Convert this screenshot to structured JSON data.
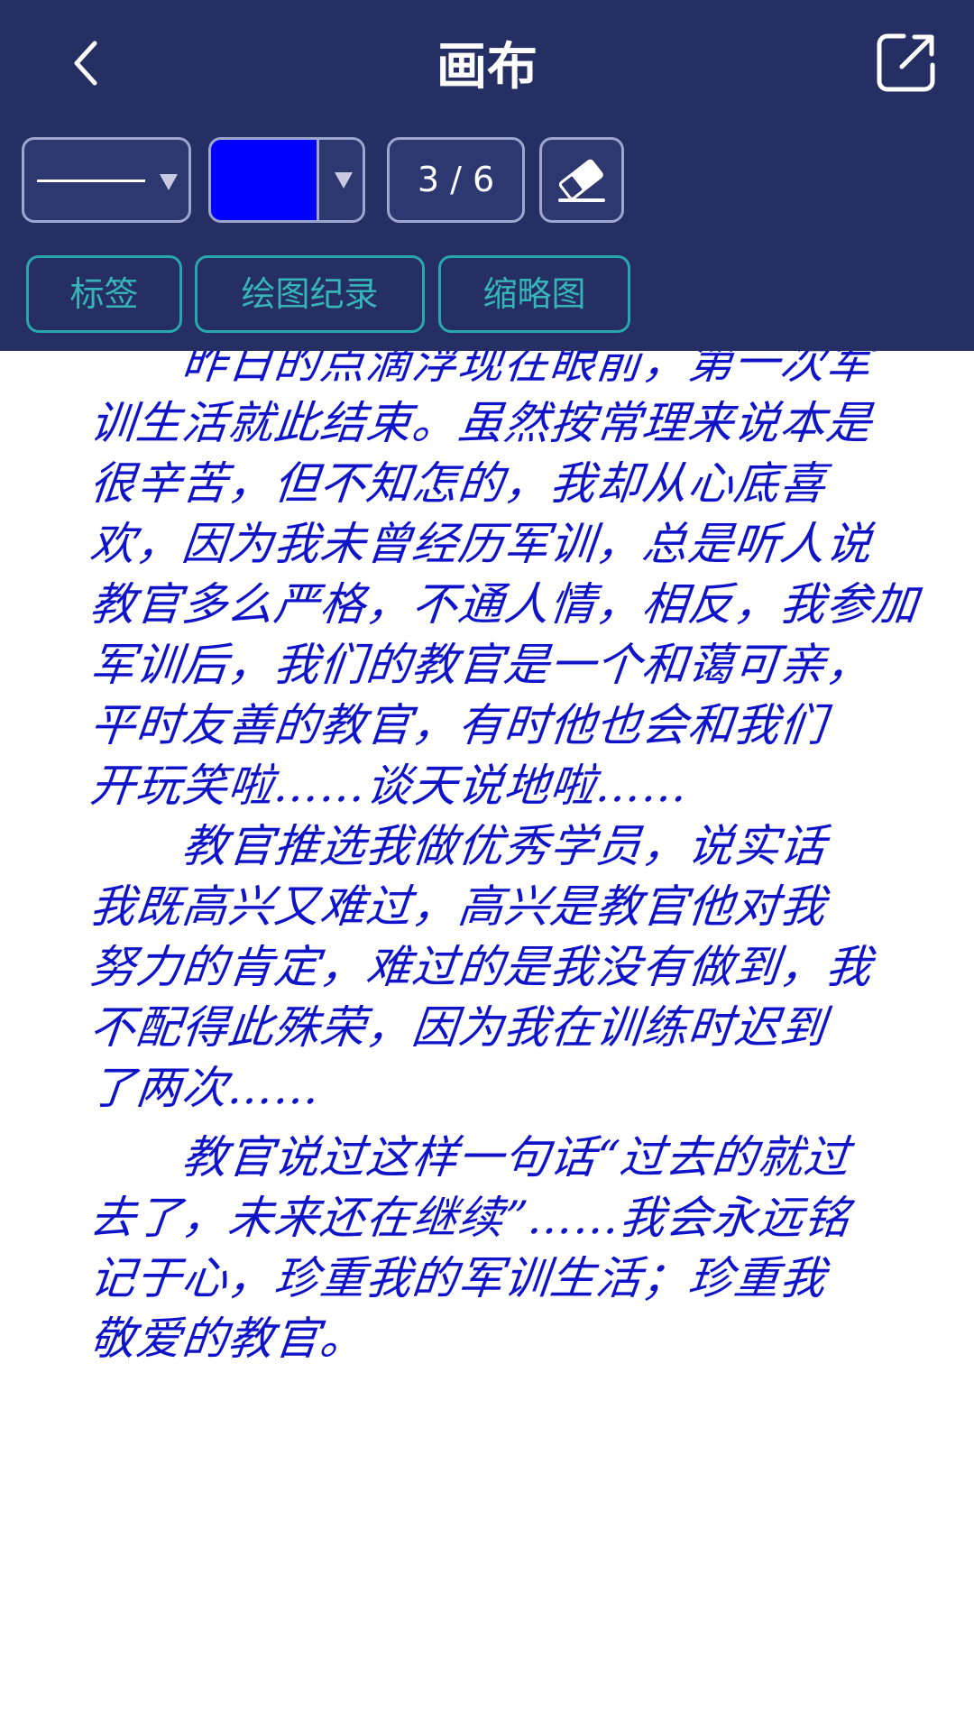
{
  "header": {
    "title": "画布",
    "back_icon": "chevron-left-icon",
    "share_icon": "share-external-icon"
  },
  "toolbar": {
    "line_style": "solid",
    "pen_color": "#0000ff",
    "page_indicator": "3 / 6",
    "eraser_icon": "eraser-icon"
  },
  "tabs": [
    {
      "label": "标签"
    },
    {
      "label": "绘图纪录"
    },
    {
      "label": "缩略图"
    }
  ],
  "canvas": {
    "ink_color": "#0f14c8",
    "lines": [
      "　　昨日的点滴浮现在眼前，第一次军",
      "训生活就此结束。虽然按常理来说本是",
      "很辛苦，但不知怎的，我却从心底喜",
      "欢，因为我未曾经历军训，总是听人说",
      "教官多么严格，不通人情，相反，我参加",
      "军训后，我们的教官是一个和蔼可亲，",
      "平时友善的教官，有时他也会和我们",
      "开玩笑啦……谈天说地啦……",
      "　　教官推选我做优秀学员，说实话",
      "我既高兴又难过，高兴是教官他对我",
      "努力的肯定，难过的是我没有做到，我",
      "不配得此殊荣，因为我在训练时迟到",
      "了两次……",
      "　　教官说过这样一句话“过去的就过",
      "去了，未来还在继续”……我会永远铭",
      "记于心，珍重我的军训生活；珍重我",
      "敬爱的教官。"
    ]
  }
}
